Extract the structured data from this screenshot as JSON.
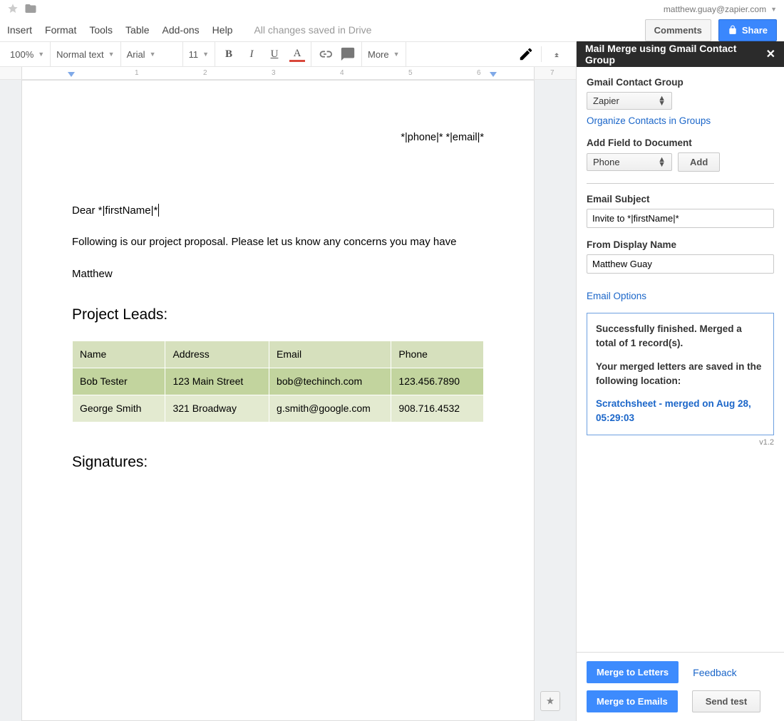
{
  "header": {
    "user_email": "matthew.guay@zapier.com",
    "comments_label": "Comments",
    "share_label": "Share"
  },
  "menu": {
    "items": [
      "Insert",
      "Format",
      "Tools",
      "Table",
      "Add-ons",
      "Help"
    ],
    "save_status": "All changes saved in Drive"
  },
  "toolbar": {
    "zoom": "100%",
    "style": "Normal text",
    "font": "Arial",
    "size": "11",
    "more": "More"
  },
  "ruler": {
    "ticks": [
      "1",
      "2",
      "3",
      "4",
      "5",
      "6",
      "7"
    ]
  },
  "document": {
    "header_right": "*|phone|* *|email|*",
    "greeting": "Dear *|firstName|*",
    "body": "Following is our project proposal. Please let us know any concerns you may have",
    "signoff": "Matthew",
    "section_leads": "Project Leads:",
    "section_signatures": "Signatures:",
    "table": {
      "headers": [
        "Name",
        "Address",
        "Email",
        "Phone"
      ],
      "rows": [
        {
          "name": "Bob Tester",
          "address": "123 Main Street",
          "email": "bob@techinch.com",
          "phone": "123.456.7890"
        },
        {
          "name": "George Smith",
          "address": "321 Broadway",
          "email": "g.smith@google.com",
          "phone": "908.716.4532"
        }
      ]
    }
  },
  "sidebar": {
    "title": "Mail Merge using Gmail Contact Group",
    "contact_group_label": "Gmail Contact Group",
    "contact_group_value": "Zapier",
    "organize_link": "Organize Contacts in Groups",
    "add_field_label": "Add Field to Document",
    "add_field_value": "Phone",
    "add_button": "Add",
    "subject_label": "Email Subject",
    "subject_value": "Invite to *|firstName|*",
    "from_label": "From Display Name",
    "from_value": "Matthew Guay",
    "email_options": "Email Options",
    "status_line1": "Successfully finished. Merged a total of 1 record(s).",
    "status_line2": "Your merged letters are saved in the following location:",
    "status_link": "Scratchsheet - merged on Aug 28, 05:29:03",
    "version": "v1.2",
    "merge_letters": "Merge to Letters",
    "merge_emails": "Merge to Emails",
    "feedback": "Feedback",
    "send_test": "Send test"
  }
}
